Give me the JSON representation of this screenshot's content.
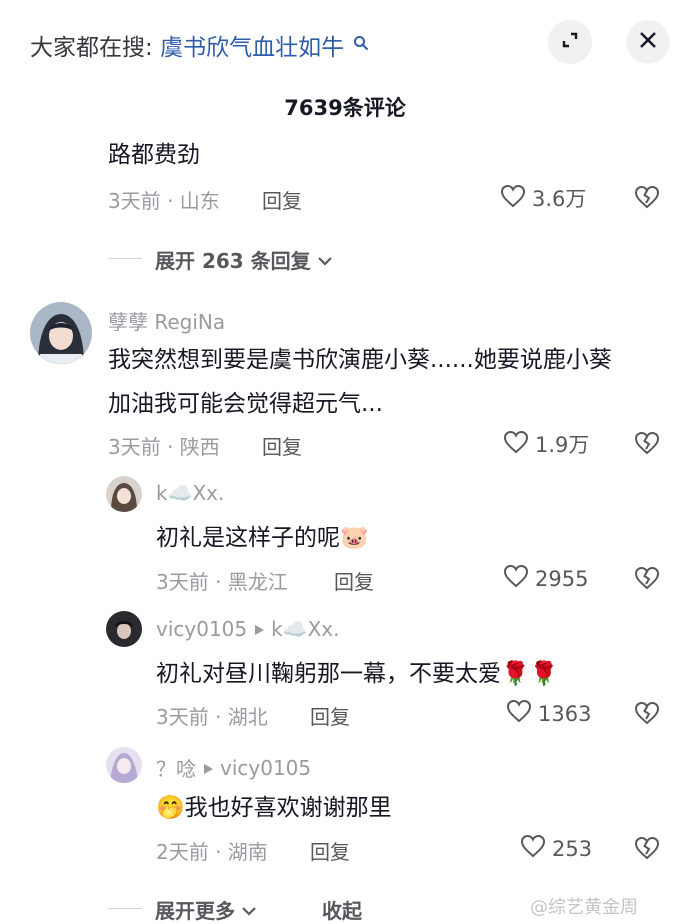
{
  "header": {
    "search_prefix": "大家都在搜:",
    "search_term": "虞书欣气血壮如牛",
    "comment_count_title": "7639条评论"
  },
  "comments": [
    {
      "text": "路都费劲",
      "meta": "3天前 · 山东",
      "reply_label": "回复",
      "likes": "3.6万",
      "expand_label": "展开 263 条回复"
    },
    {
      "username": "孽孽 RegiNa",
      "text_line1": "我突然想到要是虞书欣演鹿小葵......她要说鹿小葵",
      "text_line2": "加油我可能会觉得超元气...",
      "meta": "3天前 · 陕西",
      "reply_label": "回复",
      "likes": "1.9万"
    }
  ],
  "replies": [
    {
      "username": "k☁️Xx.",
      "text": "初礼是这样子的呢🐷",
      "meta": "3天前 · 黑龙江",
      "reply_label": "回复",
      "likes": "2955"
    },
    {
      "username": "vicy0105",
      "reply_to": "k☁️Xx.",
      "text": "初礼对昼川鞠躬那一幕，不要太爱🌹🌹",
      "meta": "3天前 · 湖北",
      "reply_label": "回复",
      "likes": "1363"
    },
    {
      "username": "？唸",
      "reply_to": "vicy0105",
      "text": "🤭我也好喜欢谢谢那里",
      "meta": "2天前 · 湖南",
      "reply_label": "回复",
      "likes": "253"
    }
  ],
  "footer": {
    "expand_more_label": "展开更多",
    "collapse_label": "收起",
    "watermark": "@综艺黄金周"
  },
  "colors": {
    "search_term": "#2f5ea8",
    "meta_gray": "#9a9ba0",
    "text_dark": "#161823"
  }
}
